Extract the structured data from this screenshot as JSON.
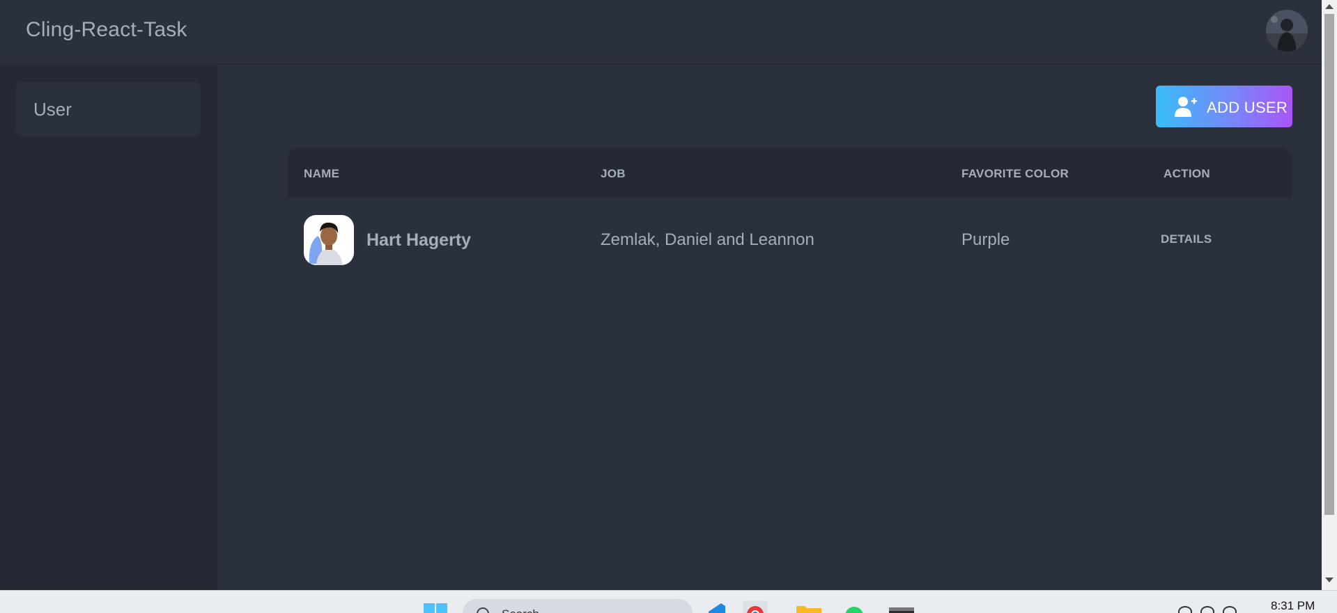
{
  "app": {
    "title": "Cling-React-Task"
  },
  "sidebar": {
    "items": [
      {
        "label": "User"
      }
    ]
  },
  "toolbar": {
    "add_user_label": "ADD USER"
  },
  "table": {
    "columns": [
      "NAME",
      "JOB",
      "FAVORITE COLOR",
      "ACTION"
    ],
    "rows": [
      {
        "name": "Hart Hagerty",
        "job": "Zemlak, Daniel and Leannon",
        "favorite_color": "Purple",
        "action": "DETAILS"
      }
    ]
  },
  "taskbar": {
    "search_placeholder": "Search",
    "time": "8:31 PM",
    "apps": [
      "windows-start-icon",
      "vscode-icon",
      "chrome-icon",
      "file-explorer-icon",
      "whatsapp-icon",
      "terminal-icon"
    ]
  },
  "colors": {
    "background": "#2a303c",
    "sidebar": "#242933",
    "text": "#a6adbb",
    "button_gradient_start": "#38bdf8",
    "button_gradient_end": "#a855f7"
  }
}
